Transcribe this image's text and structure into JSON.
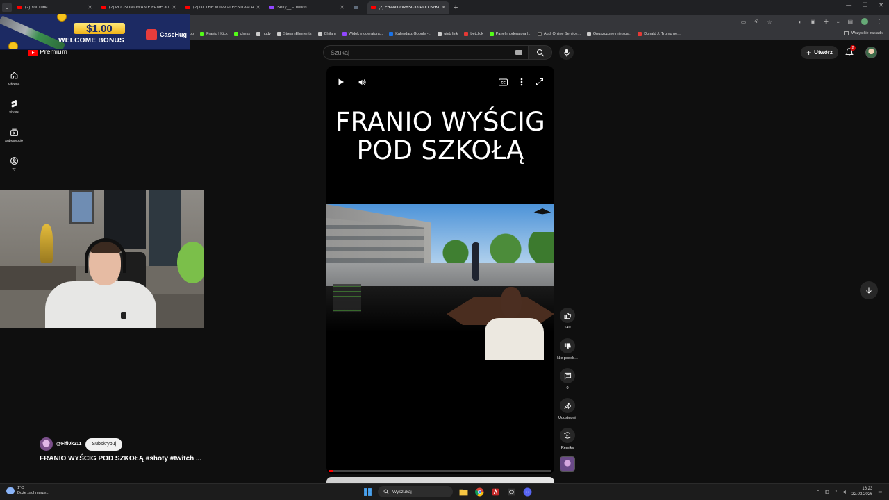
{
  "browser": {
    "tabs": [
      {
        "title": "(2) YouTube",
        "favicon": "youtube-icon",
        "active": false
      },
      {
        "title": "(2) PODSUMOWANIE FAME 30",
        "favicon": "youtube-icon",
        "active": false
      },
      {
        "title": "(2) DJ THE M live at FESTIVALA",
        "favicon": "youtube-icon",
        "active": false
      },
      {
        "title": "Setty__ - Twitch",
        "favicon": "twitch-icon",
        "active": false
      },
      {
        "title": "",
        "favicon": "generic-icon",
        "active": false
      },
      {
        "title": "(2) FRANIO WYŚCIG POD SZKO",
        "favicon": "youtube-icon",
        "active": true
      }
    ],
    "new_tab": "+",
    "bookmarks": [
      {
        "label": "op",
        "icon": "none"
      },
      {
        "label": "Franio | Kick",
        "icon": "kick-icon"
      },
      {
        "label": "chess",
        "icon": "chess-icon"
      },
      {
        "label": "nudy",
        "icon": "folder-icon"
      },
      {
        "label": "StreamElements",
        "icon": "streamelements-icon"
      },
      {
        "label": "Chilam",
        "icon": "globe-icon"
      },
      {
        "label": "Widok moderatora...",
        "icon": "twitch-icon"
      },
      {
        "label": "Kalendarz Google -...",
        "icon": "calendar-icon"
      },
      {
        "label": "ujeb link",
        "icon": "globe-icon"
      },
      {
        "label": "betclick",
        "icon": "betclic-icon"
      },
      {
        "label": "Panel moderatora |...",
        "icon": "kick-icon"
      },
      {
        "label": "Audi Online Service...",
        "icon": "audi-icon"
      },
      {
        "label": "Opuszczone miejsca...",
        "icon": "globe-icon"
      },
      {
        "label": "Donald J. Trump ne...",
        "icon": "cnn-icon"
      }
    ],
    "bookmarks_all": "Wszystkie zakładki"
  },
  "ad_banner": {
    "amount": "$1.00",
    "text": "WELCOME BONUS",
    "brand": "CaseHug"
  },
  "youtube": {
    "logo_text": "Premium",
    "search_placeholder": "Szukaj",
    "create_label": "Utwórz",
    "notifications_badge": "2",
    "guide": [
      {
        "label": "Główna",
        "icon": "home-icon"
      },
      {
        "label": "Shorts",
        "icon": "shorts-icon"
      },
      {
        "label": "Subskrypcje",
        "icon": "subscriptions-icon"
      },
      {
        "label": "Ty",
        "icon": "you-icon"
      }
    ],
    "short": {
      "overlay_title": "FRANIO WYŚCIG POD SZKOŁĄ",
      "progress": 0.018,
      "likes": "149",
      "dislike_label": "Nie podob...",
      "comments": "0",
      "share_label": "Udostępnij",
      "remix_label": "Remiks",
      "channel": "@Fifl0k211",
      "subscribe_label": "Subskrybuj",
      "title": "FRANIO WYŚCIG POD SZKOŁĄ #shoty #twitch ..."
    }
  },
  "taskbar": {
    "weather_temp": "1°C",
    "weather_desc": "Duże zachmurze...",
    "search_label": "Wyszukaj",
    "time": "16:23",
    "date": "22.03.2026"
  }
}
